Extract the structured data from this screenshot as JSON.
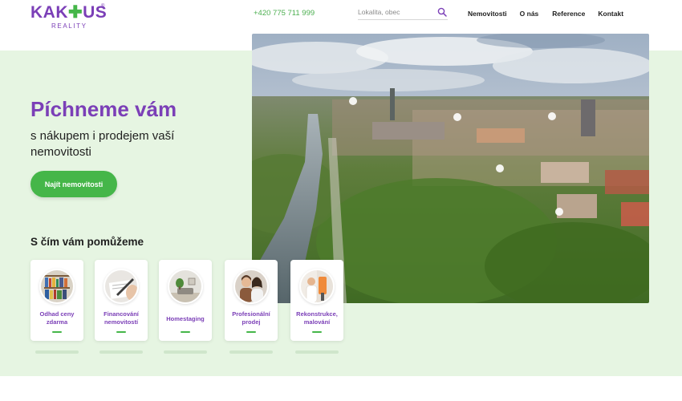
{
  "header": {
    "logo": {
      "word_start": "KAK",
      "word_cactus": "✚",
      "word_end": "US",
      "registered": "®",
      "sub": "REALITY"
    },
    "phone": "+420 775 711 999",
    "search": {
      "placeholder": "Lokalita, obec",
      "value": ""
    },
    "nav": [
      "Nemovitosti",
      "O nás",
      "Reference",
      "Kontakt"
    ]
  },
  "hero": {
    "headline": "Píchneme vám",
    "subline": "s nákupem i prodejem vaší nemovitosti",
    "cta_label": "Najít nemovitosti"
  },
  "services": {
    "title": "S čím vám pomůžeme",
    "cards": [
      {
        "label": "Odhad ceny zdarma",
        "icon": "bookshelf-photo"
      },
      {
        "label": "Financování nemovitostí",
        "icon": "signing-document-photo"
      },
      {
        "label": "Homestaging",
        "icon": "interior-photo"
      },
      {
        "label": "Profesionální prodej",
        "icon": "couple-photo"
      },
      {
        "label": "Rekonstrukce, malování",
        "icon": "painting-photo"
      }
    ]
  },
  "colors": {
    "brand_purple": "#7b3fb7",
    "brand_green": "#45b649",
    "hero_bg": "#e6f5e2"
  }
}
